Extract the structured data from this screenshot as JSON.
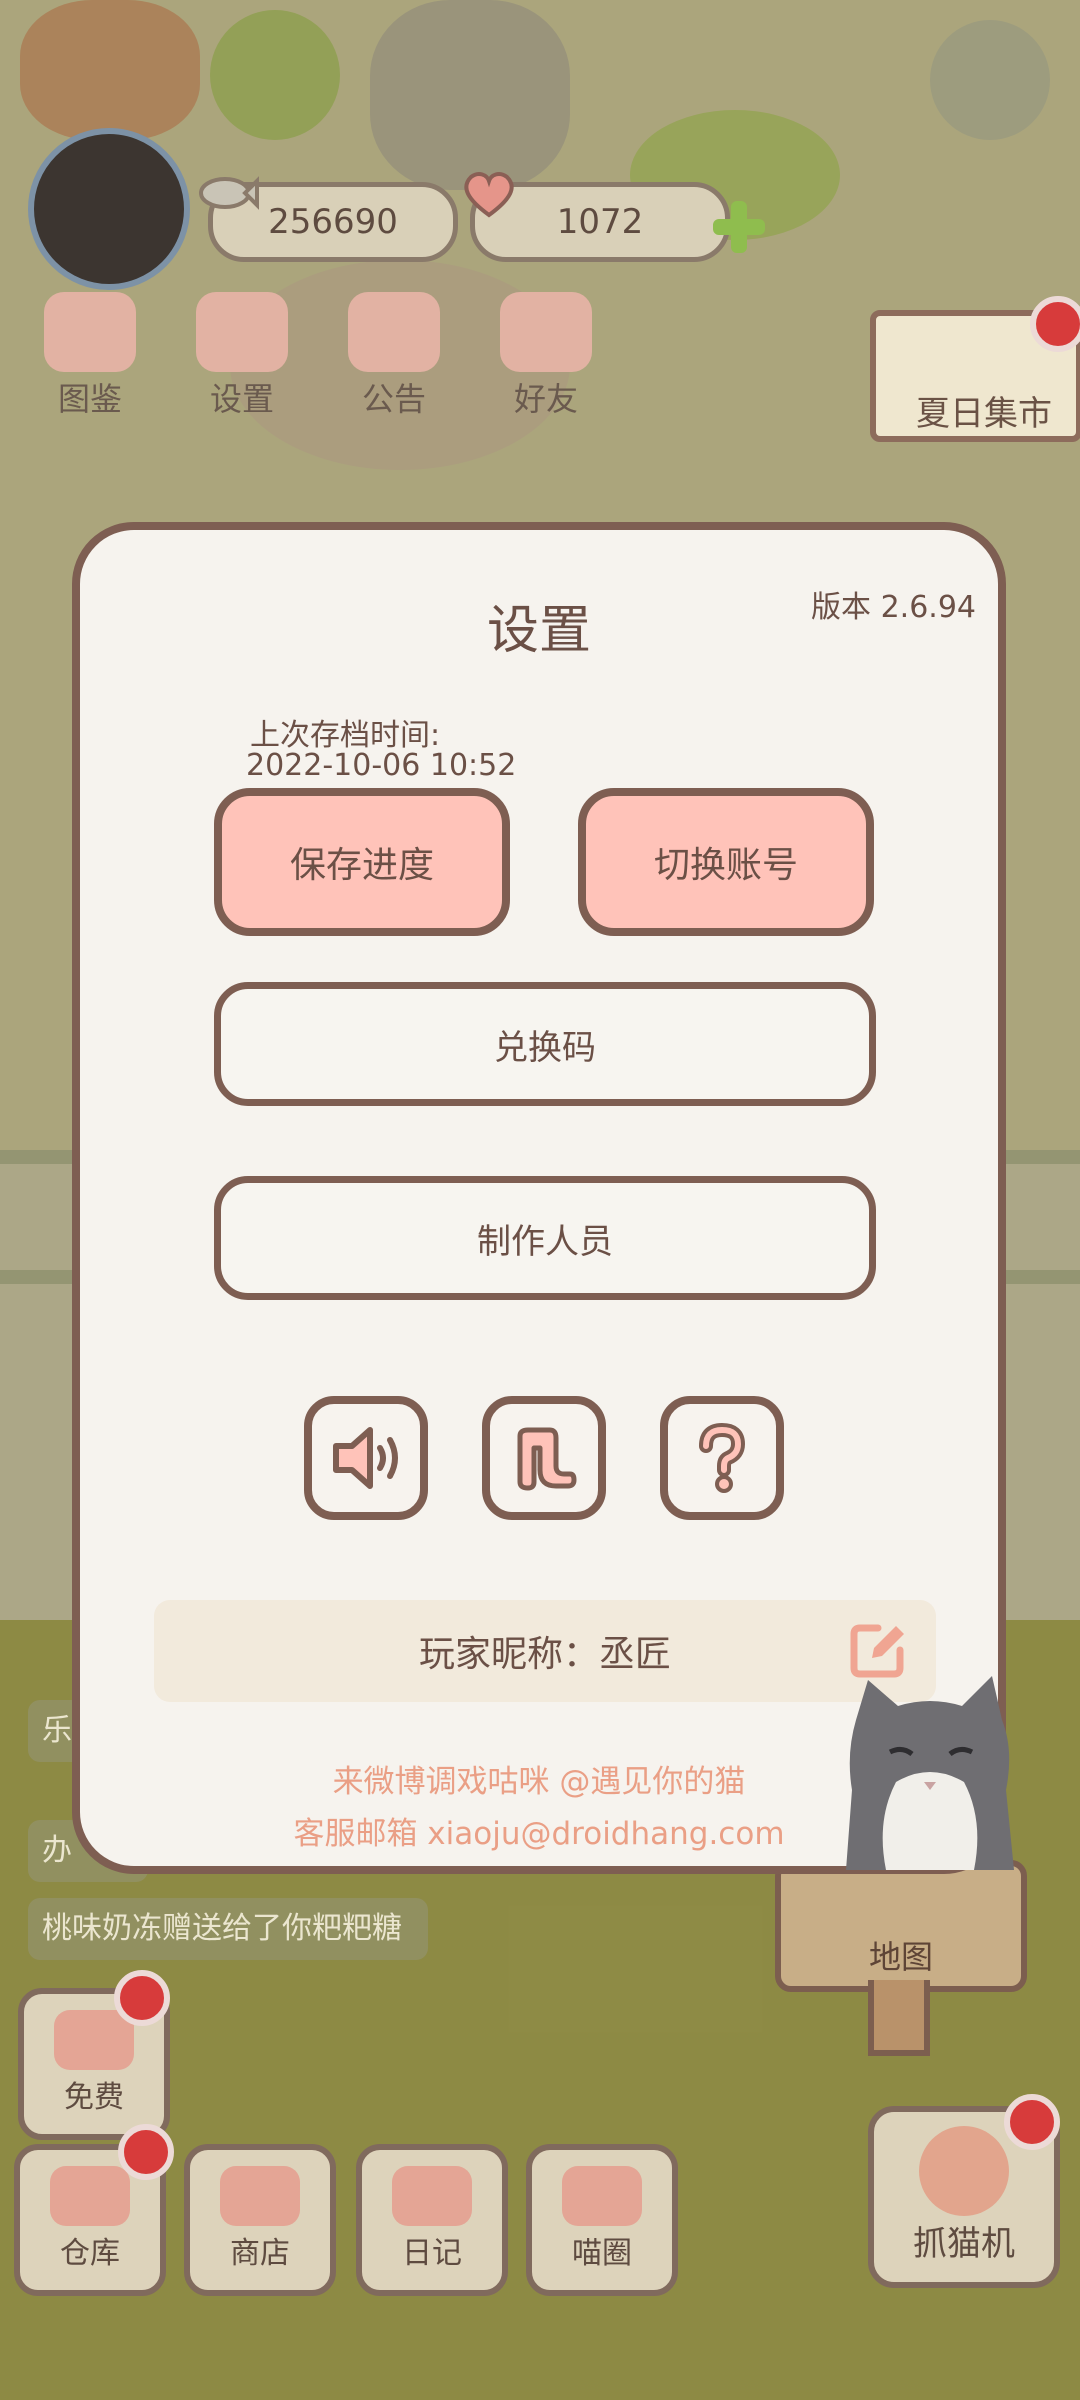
{
  "hud": {
    "coins": "256690",
    "hearts": "1072",
    "menu": [
      {
        "label": "图鉴"
      },
      {
        "label": "设置"
      },
      {
        "label": "公告"
      },
      {
        "label": "好友"
      }
    ],
    "event_label": "夏日集市"
  },
  "chat": {
    "messages": [
      "乐",
      "办",
      "桃味奶冻赠送给了你粑粑糖"
    ]
  },
  "map": {
    "label": "地图"
  },
  "bottom": {
    "free_label": "免费",
    "warehouse_label": "仓库",
    "shop_label": "商店",
    "diary_label": "日记",
    "circle_label": "喵圈",
    "claw_label": "抓猫机"
  },
  "settings": {
    "title": "设置",
    "version": "版本 2.6.94",
    "last_save_label": "上次存档时间:",
    "last_save_time": "2022-10-06 10:52",
    "save_button": "保存进度",
    "switch_account_button": "切换账号",
    "redeem_button": "兑换码",
    "credits_button": "制作人员",
    "icons": [
      "speaker-icon",
      "music-note-icon",
      "question-icon"
    ],
    "nickname": "玩家昵称：丞匠",
    "weibo": "来微博调戏咕咪 @遇见你的猫",
    "email": "客服邮箱 xiaoju@droidhang.com"
  },
  "colors": {
    "accent_pink": "#ffc3b9",
    "border_brown": "#7e5e52",
    "link_orange": "#ea9f85",
    "badge_red": "#d73b3b"
  }
}
